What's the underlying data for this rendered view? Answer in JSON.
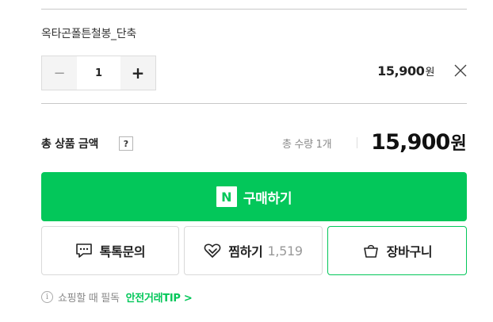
{
  "option": {
    "name": "옥타곤폴튼철봉_단축",
    "quantity": "1",
    "decrement_symbol": "−",
    "increment_symbol": "+",
    "price": "15,900",
    "price_unit": "원"
  },
  "total": {
    "label": "총 상품 금액",
    "help_symbol": "?",
    "quantity_text": "총 수량 1개",
    "price": "15,900",
    "price_unit": "원"
  },
  "buy": {
    "npay_mark": "N",
    "label": "구매하기"
  },
  "actions": {
    "talk_label": "톡톡문의",
    "zzim_label": "찜하기",
    "zzim_count": "1,519",
    "cart_label": "장바구니"
  },
  "tip": {
    "info_symbol": "i",
    "text": "쇼핑할 때 필독",
    "link": "안전거래TIP >"
  },
  "colors": {
    "brand_green": "#03c75a",
    "border": "#d9d9d9",
    "muted_text": "#888888"
  },
  "icons": [
    "close-icon",
    "chat-icon",
    "heart-icon",
    "shopping-bag-icon",
    "info-icon",
    "npay-logo"
  ]
}
